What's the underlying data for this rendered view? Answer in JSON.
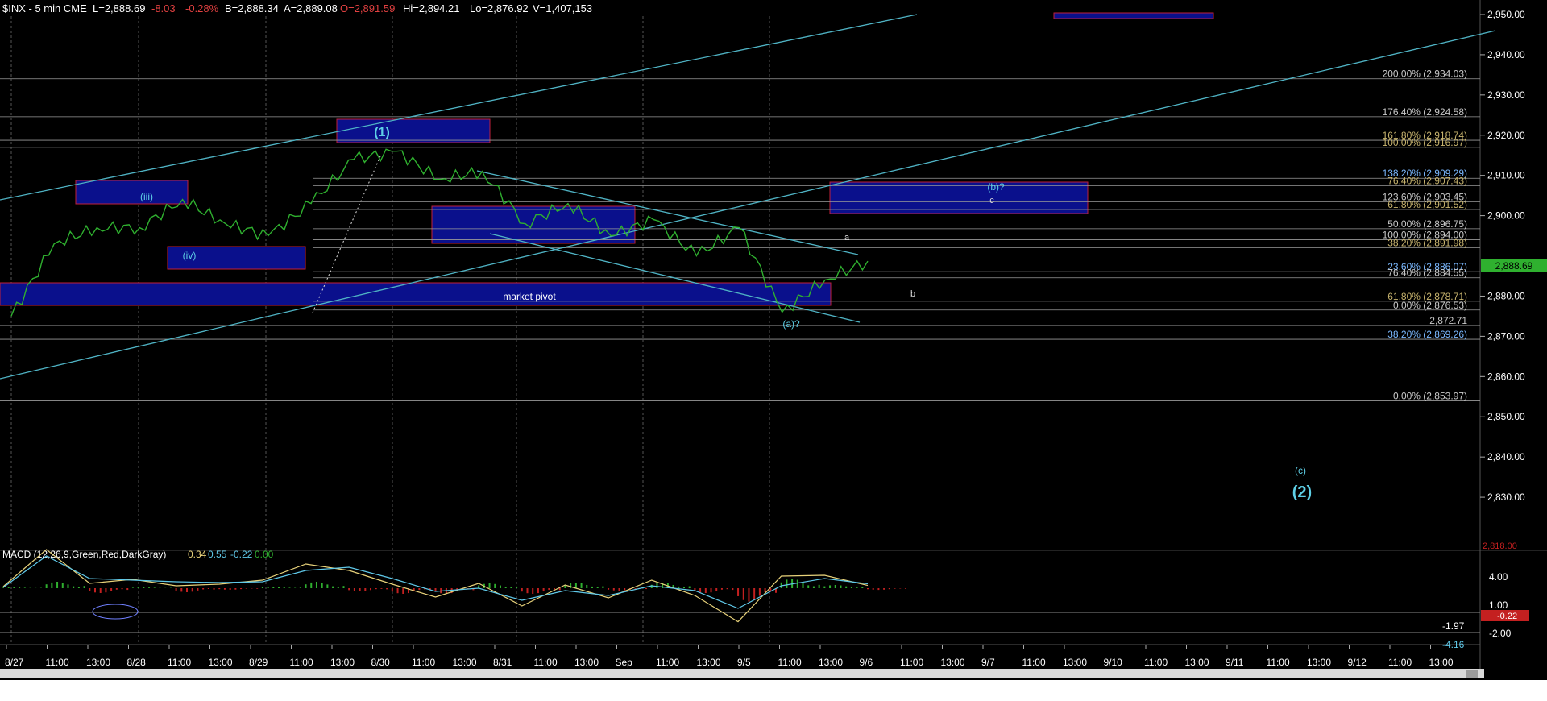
{
  "header": {
    "symbol": "$INX - 5 min  CME",
    "last": "L=2,888.69",
    "change": "-8.03",
    "pct": "-0.28%",
    "bid": "B=2,888.34",
    "ask": "A=2,889.08",
    "open": "O=2,891.59",
    "high": "Hi=2,894.21",
    "low": "Lo=2,876.92",
    "volume": "V=1,407,153"
  },
  "colors": {
    "background": "#000000",
    "price": "#2fb02f",
    "channel": "#4fb3c4",
    "fib_gray": "#c8c8c8",
    "fib_gold": "#c8b46e",
    "fib_blue": "#7ab8ff",
    "box_fill": "#0a108c",
    "box_border": "#c0203a",
    "macd_line": "#e8d27a",
    "signal_line": "#5fc8e8",
    "hist_up": "#2fb02f",
    "hist_down": "#c42020"
  },
  "price_axis": {
    "ticks": [
      "2,950.00",
      "2,940.00",
      "2,930.00",
      "2,920.00",
      "2,910.00",
      "2,900.00",
      "2,880.00",
      "2,870.00",
      "2,860.00",
      "2,850.00",
      "2,840.00",
      "2,830.00"
    ],
    "current_value": "2,888.69",
    "cut_label": "2,818.00",
    "ylim": [
      2818,
      2952
    ]
  },
  "time_axis": {
    "labels": [
      "8/27",
      "11:00",
      "13:00",
      "8/28",
      "11:00",
      "13:00",
      "8/29",
      "11:00",
      "13:00",
      "8/30",
      "11:00",
      "13:00",
      "8/31",
      "11:00",
      "13:00",
      "Sep",
      "11:00",
      "13:00",
      "9/5",
      "11:00",
      "13:00",
      "9/6",
      "11:00",
      "13:00",
      "9/7",
      "11:00",
      "13:00",
      "9/10",
      "11:00",
      "13:00",
      "9/11",
      "11:00",
      "13:00",
      "9/12",
      "11:00",
      "13:00"
    ]
  },
  "fib_levels": [
    {
      "label": "200.00% (2,934.03)",
      "value": 2934.03,
      "tone": "gray"
    },
    {
      "label": "176.40% (2,924.58)",
      "value": 2924.58,
      "tone": "gray"
    },
    {
      "label": "161.80% (2,918.74)",
      "value": 2918.74,
      "tone": "gold"
    },
    {
      "label": "100.00% (2,916.97)",
      "value": 2916.97,
      "tone": "gold"
    },
    {
      "label": "138.20% (2,909.29)",
      "value": 2909.29,
      "tone": "blue"
    },
    {
      "label": "76.40% (2,907.43)",
      "value": 2907.43,
      "tone": "gold"
    },
    {
      "label": "123.60% (2,903.45)",
      "value": 2903.45,
      "tone": "gray"
    },
    {
      "label": "61.80% (2,901.52)",
      "value": 2901.52,
      "tone": "gold"
    },
    {
      "label": "50.00% (2,896.75)",
      "value": 2896.75,
      "tone": "gray"
    },
    {
      "label": "100.00% (2,894.00)",
      "value": 2894.0,
      "tone": "gray"
    },
    {
      "label": "38.20% (2,891.98)",
      "value": 2891.98,
      "tone": "gold"
    },
    {
      "label": "23.60% (2,886.07)",
      "value": 2886.07,
      "tone": "blue"
    },
    {
      "label": "76.40% (2,884.55)",
      "value": 2884.55,
      "tone": "gray"
    },
    {
      "label": "61.80% (2,878.71)",
      "value": 2878.71,
      "tone": "gold"
    },
    {
      "label": "0.00% (2,876.53)",
      "value": 2876.53,
      "tone": "gray"
    },
    {
      "label": "2,872.71",
      "value": 2872.71,
      "tone": "gray"
    },
    {
      "label": "38.20% (2,869.26)",
      "value": 2869.26,
      "tone": "blue"
    },
    {
      "label": "0.00% (2,853.97)",
      "value": 2853.97,
      "tone": "gray"
    }
  ],
  "annotations": {
    "wave_1": "(1)",
    "wave_iii": "(iii)",
    "wave_iv": "(iv)",
    "market_pivot": "market pivot",
    "wave_a_q": "(a)?",
    "wave_b_q": "(b)?",
    "small_a": "a",
    "small_b": "b",
    "small_c": "c",
    "wave_c": "(c)",
    "wave_2": "(2)"
  },
  "macd": {
    "title": "MACD (12,26,9,Green,Red,DarkGray)",
    "v1": "0.34",
    "v2": "0.55",
    "v3": "-0.22",
    "v4": "0.00",
    "ticks": [
      "4.00",
      "1.00",
      "-2.00"
    ],
    "markers": [
      "-0.22",
      "-1.97",
      "-4.16"
    ]
  },
  "chart_data": {
    "type": "line",
    "title": "$INX - 5 min",
    "xlabel": "",
    "ylabel": "",
    "ylim": [
      2818,
      2952
    ],
    "series": [
      {
        "x": [
          "8/27",
          "8/27 11:00",
          "8/27 13:00",
          "8/28",
          "8/28 11:00",
          "8/28 13:00",
          "8/29",
          "8/29 11:00",
          "8/29 13:00",
          "8/30",
          "8/30 11:00",
          "8/30 13:00",
          "8/31",
          "8/31 11:00",
          "8/31 13:00",
          "Sep",
          "Sep 11:00",
          "Sep 13:00",
          "9/5",
          "9/5 11:00",
          "9/5 13:00"
        ],
        "values": [
          2875,
          2893,
          2897,
          2897,
          2904,
          2898,
          2895,
          2903,
          2914,
          2916,
          2909,
          2911,
          2898,
          2903,
          2895,
          2899,
          2890,
          2897,
          2876,
          2884,
          2888.69
        ]
      }
    ],
    "macd": {
      "ylim": [
        -5,
        5
      ],
      "macd_line": [
        0.2,
        4.8,
        0.6,
        1.1,
        0.3,
        0.5,
        1.0,
        3.0,
        2.2,
        0.5,
        -1.1,
        0.6,
        -2.2,
        0.4,
        -1.2,
        1.0,
        -0.9,
        -4.16,
        1.5,
        1.6,
        0.34
      ],
      "signal_line": [
        0.1,
        4.0,
        1.2,
        1.0,
        0.8,
        0.7,
        0.8,
        2.2,
        2.6,
        1.2,
        -0.4,
        0.0,
        -1.5,
        -0.3,
        -0.9,
        0.3,
        -0.3,
        -2.5,
        0.3,
        1.2,
        0.55
      ]
    }
  }
}
